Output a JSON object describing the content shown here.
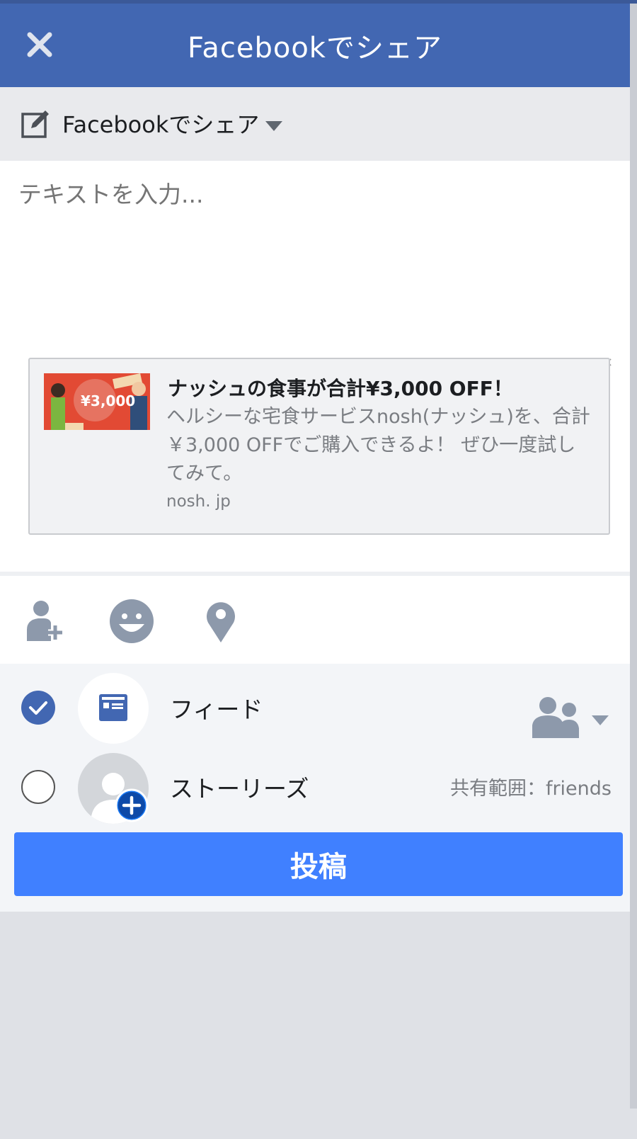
{
  "header": {
    "title": "Facebookでシェア"
  },
  "selector": {
    "label": "Facebookでシェア"
  },
  "composer": {
    "placeholder": "テキストを入力..."
  },
  "link_card": {
    "title": "ナッシュの食事が合計¥3,000 OFF！",
    "description": "ヘルシーな宅食サービスnosh(ナッシュ)を、合計￥3,000 OFFでご購入できるよ！ ぜひ一度試してみて。",
    "domain": "nosh. jp",
    "thumbnail_text": "¥3,000"
  },
  "actions": [
    "tag-people-icon",
    "feeling-icon",
    "location-icon"
  ],
  "audience": {
    "feed": {
      "label": "フィード",
      "checked": true
    },
    "stories": {
      "label": "ストーリーズ",
      "checked": false,
      "privacy": "共有範囲：friends"
    }
  },
  "post_button": {
    "label": "投稿"
  },
  "colors": {
    "header": "#4267b2",
    "post_button": "#4080ff",
    "icon_gray": "#8d99ab"
  }
}
